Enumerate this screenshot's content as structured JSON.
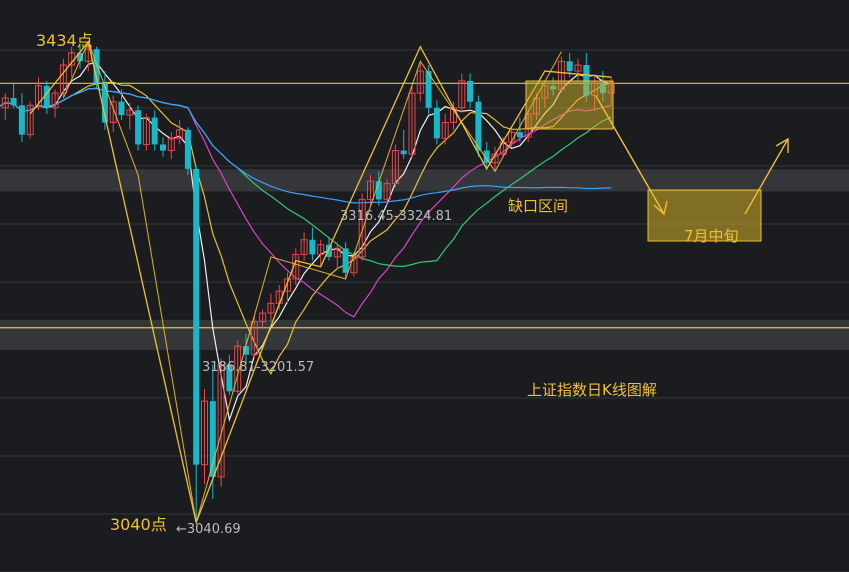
{
  "chart_data": {
    "type": "candlestick",
    "title": "上证指数日K线图解",
    "annotations": {
      "peak_label": "3434点",
      "low_label": "3040点",
      "low_value_label": "←3040.69",
      "gap_upper_label": "3316.45-3324.81",
      "gap_lower_label": "3186.81-3201.57",
      "gap_zone_label": "缺口区间",
      "forecast_label": "7月中旬"
    },
    "price_range": [
      3010,
      3460
    ],
    "key_levels": {
      "peak": 3434,
      "low": 3040.69,
      "resistance": 3400,
      "support": 3200
    },
    "gaps": [
      {
        "low": 3316.45,
        "high": 3324.81
      },
      {
        "low": 3186.81,
        "high": 3201.57
      }
    ],
    "candles": [
      [
        3393,
        3398,
        3372,
        3380
      ],
      [
        3380,
        3392,
        3370,
        3388
      ],
      [
        3388,
        3400,
        3380,
        3382
      ],
      [
        3382,
        3392,
        3352,
        3358
      ],
      [
        3358,
        3385,
        3355,
        3382
      ],
      [
        3382,
        3405,
        3378,
        3398
      ],
      [
        3398,
        3402,
        3375,
        3380
      ],
      [
        3380,
        3395,
        3372,
        3392
      ],
      [
        3392,
        3420,
        3388,
        3415
      ],
      [
        3415,
        3430,
        3405,
        3425
      ],
      [
        3425,
        3432,
        3412,
        3418
      ],
      [
        3418,
        3434,
        3410,
        3428
      ],
      [
        3428,
        3430,
        3395,
        3400
      ],
      [
        3400,
        3410,
        3362,
        3368
      ],
      [
        3368,
        3390,
        3360,
        3385
      ],
      [
        3385,
        3395,
        3370,
        3374
      ],
      [
        3374,
        3384,
        3362,
        3378
      ],
      [
        3378,
        3382,
        3345,
        3350
      ],
      [
        3350,
        3375,
        3345,
        3372
      ],
      [
        3372,
        3378,
        3345,
        3350
      ],
      [
        3350,
        3356,
        3340,
        3345
      ],
      [
        3345,
        3360,
        3338,
        3355
      ],
      [
        3355,
        3370,
        3350,
        3362
      ],
      [
        3362,
        3364,
        3325,
        3330
      ],
      [
        3330,
        3332,
        3040.69,
        3088
      ],
      [
        3088,
        3150,
        3072,
        3140
      ],
      [
        3140,
        3170,
        3060,
        3078
      ],
      [
        3078,
        3175,
        3070,
        3170
      ],
      [
        3170,
        3178,
        3145,
        3148
      ],
      [
        3148,
        3190,
        3146,
        3185
      ],
      [
        3185,
        3195,
        3170,
        3178
      ],
      [
        3178,
        3210,
        3175,
        3205
      ],
      [
        3205,
        3215,
        3200,
        3212
      ],
      [
        3212,
        3228,
        3205,
        3220
      ],
      [
        3220,
        3235,
        3215,
        3230
      ],
      [
        3230,
        3245,
        3220,
        3240
      ],
      [
        3240,
        3265,
        3235,
        3260
      ],
      [
        3260,
        3278,
        3255,
        3272
      ],
      [
        3272,
        3282,
        3255,
        3260
      ],
      [
        3260,
        3272,
        3250,
        3268
      ],
      [
        3268,
        3274,
        3255,
        3258
      ],
      [
        3258,
        3270,
        3248,
        3265
      ],
      [
        3265,
        3270,
        3240,
        3245
      ],
      [
        3245,
        3262,
        3242,
        3258
      ],
      [
        3258,
        3310,
        3255,
        3305
      ],
      [
        3305,
        3325,
        3300,
        3320
      ],
      [
        3320,
        3328,
        3300,
        3305
      ],
      [
        3305,
        3322,
        3300,
        3318
      ],
      [
        3318,
        3350,
        3315,
        3345
      ],
      [
        3345,
        3362,
        3338,
        3342
      ],
      [
        3342,
        3398,
        3340,
        3392
      ],
      [
        3392,
        3418,
        3385,
        3410
      ],
      [
        3410,
        3415,
        3375,
        3380
      ],
      [
        3380,
        3386,
        3350,
        3355
      ],
      [
        3355,
        3375,
        3350,
        3368
      ],
      [
        3368,
        3385,
        3362,
        3380
      ],
      [
        3380,
        3408,
        3376,
        3402
      ],
      [
        3402,
        3408,
        3380,
        3385
      ],
      [
        3385,
        3390,
        3340,
        3345
      ],
      [
        3345,
        3352,
        3330,
        3335
      ],
      [
        3335,
        3348,
        3328,
        3342
      ],
      [
        3342,
        3356,
        3340,
        3352
      ],
      [
        3352,
        3365,
        3348,
        3360
      ],
      [
        3360,
        3372,
        3352,
        3356
      ],
      [
        3356,
        3378,
        3352,
        3375
      ],
      [
        3375,
        3392,
        3370,
        3388
      ],
      [
        3388,
        3402,
        3380,
        3398
      ],
      [
        3398,
        3405,
        3390,
        3395
      ],
      [
        3395,
        3422,
        3392,
        3418
      ],
      [
        3418,
        3425,
        3405,
        3410
      ],
      [
        3410,
        3420,
        3402,
        3415
      ],
      [
        3415,
        3425,
        3385,
        3390
      ],
      [
        3390,
        3405,
        3378,
        3400
      ],
      [
        3400,
        3410,
        3385,
        3392
      ],
      [
        3392,
        3405,
        3382,
        3400
      ]
    ],
    "moving_averages": [
      {
        "name": "MA5",
        "color": "#f0f0f0",
        "period": 5
      },
      {
        "name": "MA10",
        "color": "#e8c230",
        "period": 10
      },
      {
        "name": "MA20",
        "color": "#e040c8",
        "period": 20
      },
      {
        "name": "MA30",
        "color": "#2ecc71",
        "period": 30
      },
      {
        "name": "MA60",
        "color": "#3aa0ff",
        "period": 60
      }
    ],
    "colors": {
      "up": "#e8484a",
      "down": "#18b8c8",
      "annotation": "#f0c030",
      "grid": "#34363c",
      "label": "#bbbbbb"
    },
    "grid": true
  }
}
